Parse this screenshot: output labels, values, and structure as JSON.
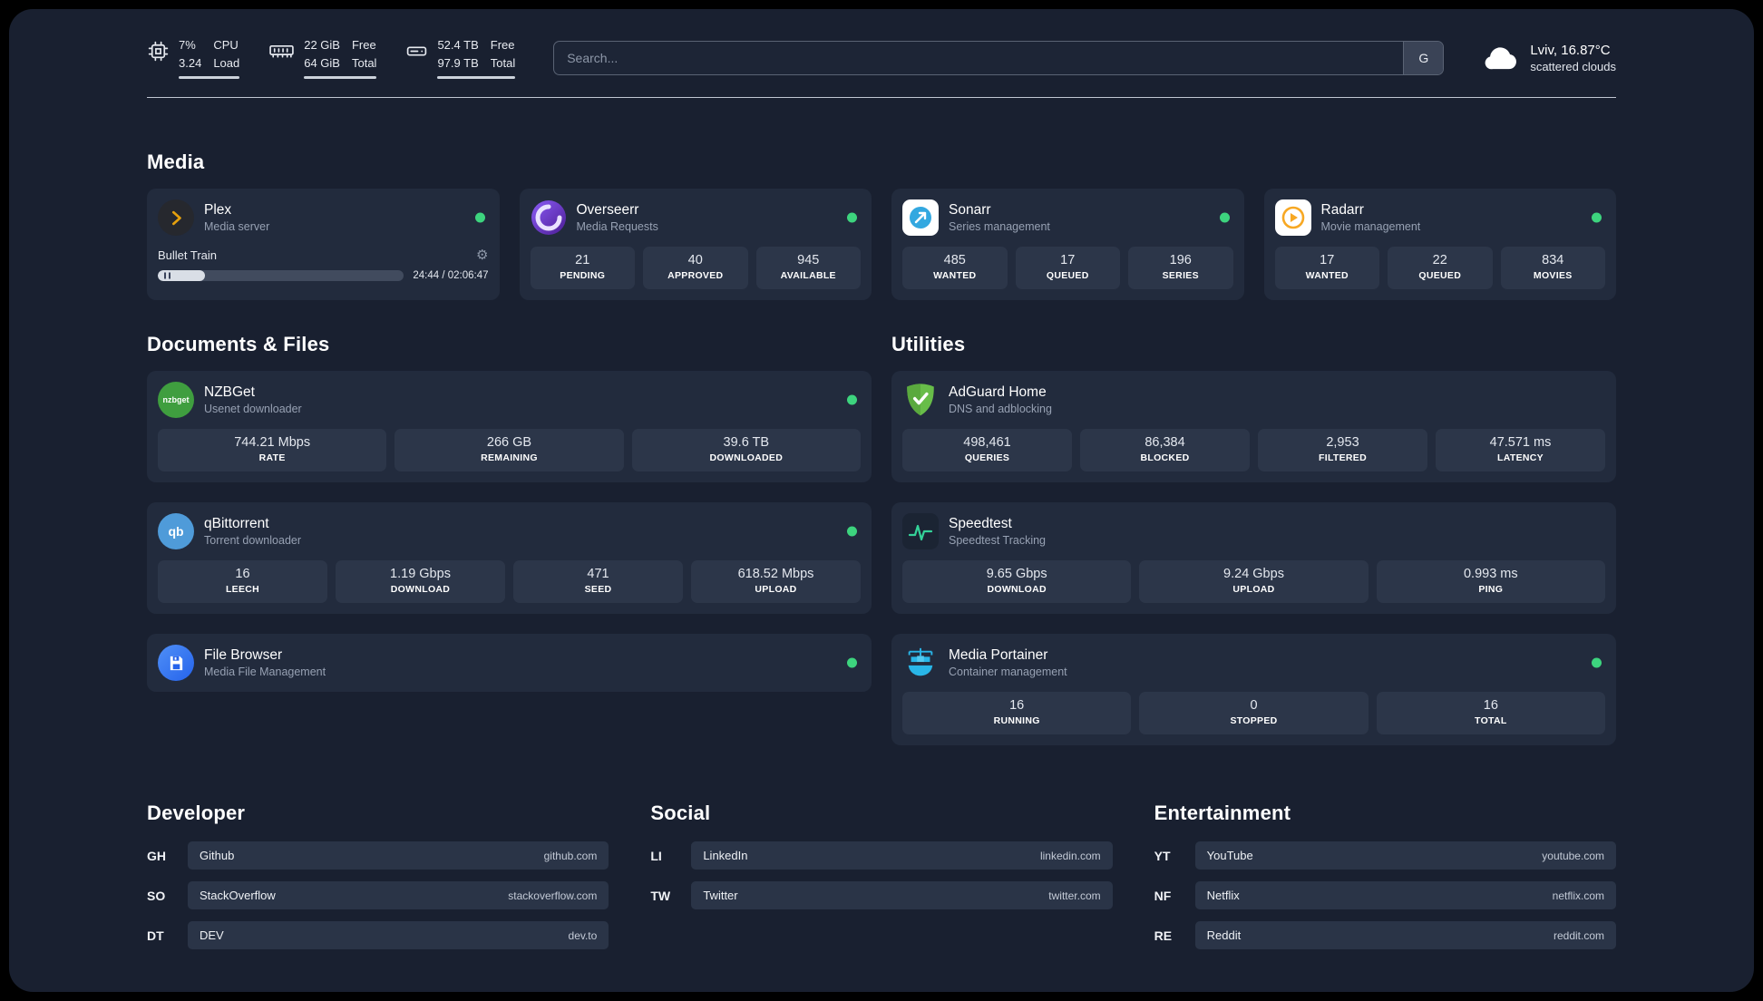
{
  "topbar": {
    "cpu": {
      "value_top": "7%",
      "value_bottom": "3.24",
      "label_top": "CPU",
      "label_bottom": "Load"
    },
    "ram": {
      "value_top": "22 GiB",
      "value_bottom": "64 GiB",
      "label_top": "Free",
      "label_bottom": "Total"
    },
    "disk": {
      "value_top": "52.4 TB",
      "value_bottom": "97.9 TB",
      "label_top": "Free",
      "label_bottom": "Total"
    },
    "search": {
      "placeholder": "Search...",
      "provider_label": "G"
    },
    "weather": {
      "location": "Lviv, 16.87°C",
      "condition": "scattered clouds"
    }
  },
  "media": {
    "title": "Media",
    "plex": {
      "name": "Plex",
      "subtitle": "Media server",
      "now_playing": "Bullet Train",
      "time": "24:44 / 02:06:47",
      "progress_percent": 19
    },
    "overseerr": {
      "name": "Overseerr",
      "subtitle": "Media Requests",
      "stats": [
        {
          "value": "21",
          "label": "PENDING"
        },
        {
          "value": "40",
          "label": "APPROVED"
        },
        {
          "value": "945",
          "label": "AVAILABLE"
        }
      ]
    },
    "sonarr": {
      "name": "Sonarr",
      "subtitle": "Series management",
      "stats": [
        {
          "value": "485",
          "label": "WANTED"
        },
        {
          "value": "17",
          "label": "QUEUED"
        },
        {
          "value": "196",
          "label": "SERIES"
        }
      ]
    },
    "radarr": {
      "name": "Radarr",
      "subtitle": "Movie management",
      "stats": [
        {
          "value": "17",
          "label": "WANTED"
        },
        {
          "value": "22",
          "label": "QUEUED"
        },
        {
          "value": "834",
          "label": "MOVIES"
        }
      ]
    }
  },
  "documents": {
    "title": "Documents & Files",
    "nzbget": {
      "name": "NZBGet",
      "subtitle": "Usenet downloader",
      "icon_text": "nzbget",
      "stats": [
        {
          "value": "744.21 Mbps",
          "label": "RATE"
        },
        {
          "value": "266 GB",
          "label": "REMAINING"
        },
        {
          "value": "39.6 TB",
          "label": "DOWNLOADED"
        }
      ]
    },
    "qbittorrent": {
      "name": "qBittorrent",
      "subtitle": "Torrent downloader",
      "icon_text": "qb",
      "stats": [
        {
          "value": "16",
          "label": "LEECH"
        },
        {
          "value": "1.19 Gbps",
          "label": "DOWNLOAD"
        },
        {
          "value": "471",
          "label": "SEED"
        },
        {
          "value": "618.52 Mbps",
          "label": "UPLOAD"
        }
      ]
    },
    "filebrowser": {
      "name": "File Browser",
      "subtitle": "Media File Management"
    }
  },
  "utilities": {
    "title": "Utilities",
    "adguard": {
      "name": "AdGuard Home",
      "subtitle": "DNS and adblocking",
      "stats": [
        {
          "value": "498,461",
          "label": "QUERIES"
        },
        {
          "value": "86,384",
          "label": "BLOCKED"
        },
        {
          "value": "2,953",
          "label": "FILTERED"
        },
        {
          "value": "47.571 ms",
          "label": "LATENCY"
        }
      ]
    },
    "speedtest": {
      "name": "Speedtest",
      "subtitle": "Speedtest Tracking",
      "stats": [
        {
          "value": "9.65 Gbps",
          "label": "DOWNLOAD"
        },
        {
          "value": "9.24 Gbps",
          "label": "UPLOAD"
        },
        {
          "value": "0.993 ms",
          "label": "PING"
        }
      ]
    },
    "portainer": {
      "name": "Media Portainer",
      "subtitle": "Container management",
      "stats": [
        {
          "value": "16",
          "label": "RUNNING"
        },
        {
          "value": "0",
          "label": "STOPPED"
        },
        {
          "value": "16",
          "label": "TOTAL"
        }
      ]
    }
  },
  "bookmarks": {
    "developer": {
      "title": "Developer",
      "links": [
        {
          "abbr": "GH",
          "name": "Github",
          "url": "github.com"
        },
        {
          "abbr": "SO",
          "name": "StackOverflow",
          "url": "stackoverflow.com"
        },
        {
          "abbr": "DT",
          "name": "DEV",
          "url": "dev.to"
        }
      ]
    },
    "social": {
      "title": "Social",
      "links": [
        {
          "abbr": "LI",
          "name": "LinkedIn",
          "url": "linkedin.com"
        },
        {
          "abbr": "TW",
          "name": "Twitter",
          "url": "twitter.com"
        }
      ]
    },
    "entertainment": {
      "title": "Entertainment",
      "links": [
        {
          "abbr": "YT",
          "name": "YouTube",
          "url": "youtube.com"
        },
        {
          "abbr": "NF",
          "name": "Netflix",
          "url": "netflix.com"
        },
        {
          "abbr": "RE",
          "name": "Reddit",
          "url": "reddit.com"
        }
      ]
    }
  },
  "colors": {
    "status_online": "#3dd47e",
    "plex_accent": "#e5a00d",
    "background": "#192030",
    "card": "#222b3d",
    "tile": "#2c3649"
  }
}
